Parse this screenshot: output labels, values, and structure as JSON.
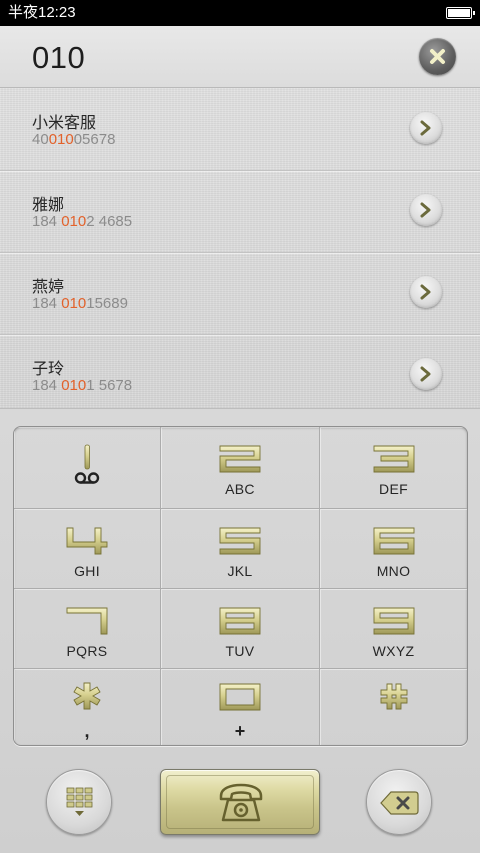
{
  "status_bar": {
    "time": "半夜12:23"
  },
  "search": {
    "query": "010"
  },
  "results": [
    {
      "name": "小米客服",
      "number_pre": "40",
      "number_match": "010",
      "number_post": "05678"
    },
    {
      "name": "雅娜",
      "number_pre": "184 ",
      "number_match": "010",
      "number_post": "2 4685"
    },
    {
      "name": "燕婷",
      "number_pre": "184 ",
      "number_match": "010",
      "number_post": "15689"
    },
    {
      "name": "子玲",
      "number_pre": "184 ",
      "number_match": "010",
      "number_post": "1 5678"
    }
  ],
  "keypad": {
    "keys": [
      {
        "digit": "1",
        "letters": ""
      },
      {
        "digit": "2",
        "letters": "ABC"
      },
      {
        "digit": "3",
        "letters": "DEF"
      },
      {
        "digit": "4",
        "letters": "GHI"
      },
      {
        "digit": "5",
        "letters": "JKL"
      },
      {
        "digit": "6",
        "letters": "MNO"
      },
      {
        "digit": "7",
        "letters": "PQRS"
      },
      {
        "digit": "8",
        "letters": "TUV"
      },
      {
        "digit": "9",
        "letters": "WXYZ"
      },
      {
        "digit": "*",
        "letters": ","
      },
      {
        "digit": "0",
        "letters": "+"
      },
      {
        "digit": "#",
        "letters": ""
      }
    ]
  },
  "icons": {
    "clear": "close-icon",
    "detail": "chevron-right-icon",
    "voicemail": "voicemail-icon",
    "keypad_toggle": "dialpad-icon",
    "call": "telephone-icon",
    "backspace": "backspace-icon"
  },
  "colors": {
    "highlight": "#e2612a",
    "gold": "#c9c48a",
    "status_bar": "#000000"
  }
}
